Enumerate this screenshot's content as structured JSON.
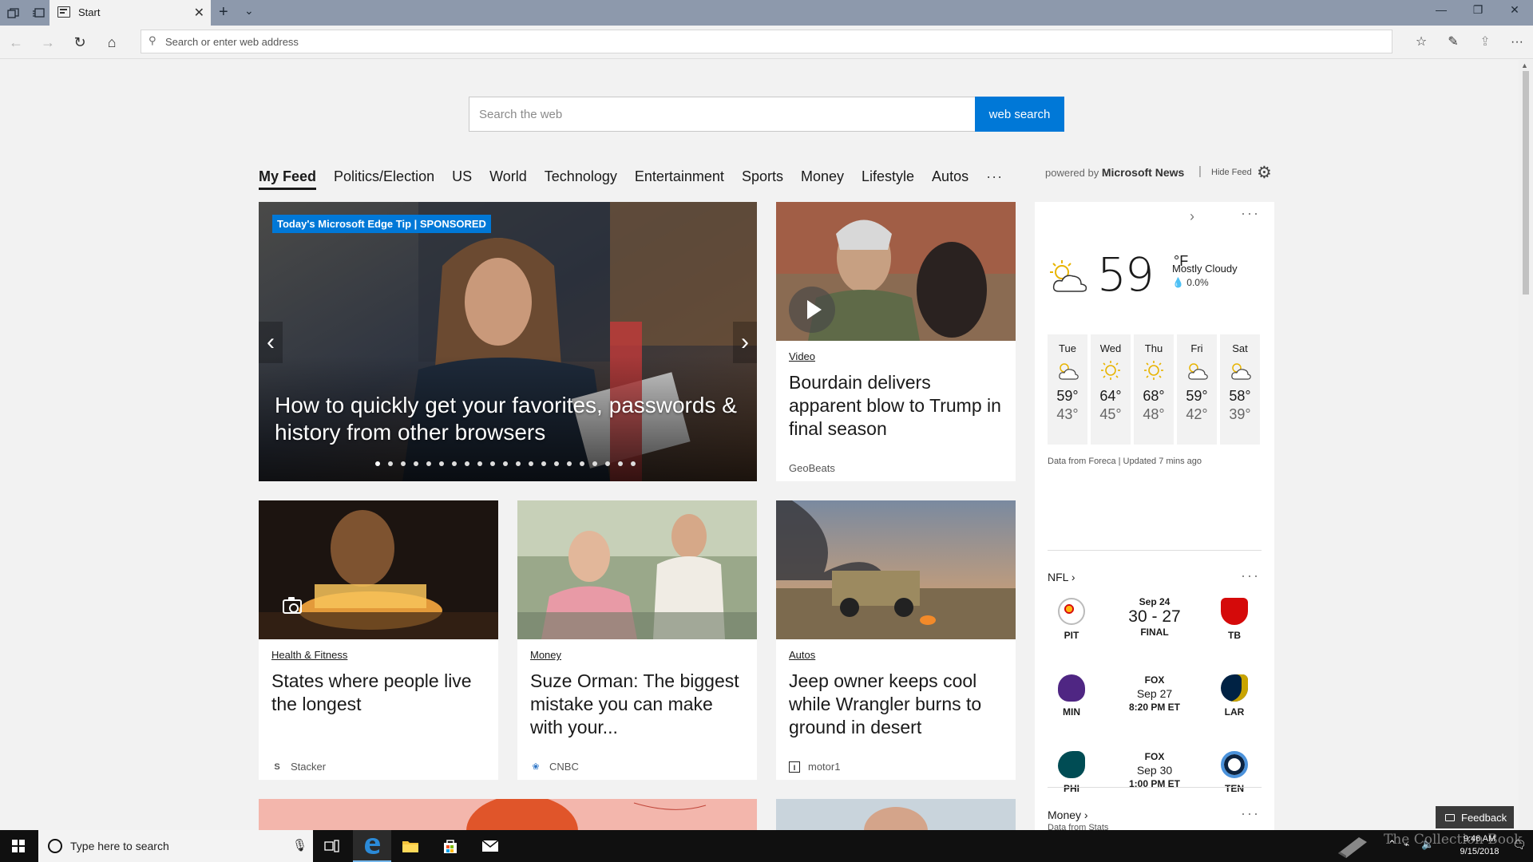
{
  "browser": {
    "tab_title": "Start",
    "address_placeholder": "Search or enter web address"
  },
  "search": {
    "placeholder": "Search the web",
    "button_label": "web search"
  },
  "feed_nav": {
    "tabs": [
      "My Feed",
      "Politics/Election",
      "US",
      "World",
      "Technology",
      "Entertainment",
      "Sports",
      "Money",
      "Lifestyle",
      "Autos"
    ],
    "more": "···",
    "powered_prefix": "powered by",
    "powered_brand": "Microsoft News",
    "separator": "|",
    "hide_feed": "Hide Feed"
  },
  "hero": {
    "badge": "Today's Microsoft Edge Tip | SPONSORED",
    "title": "How to quickly get your favorites, passwords & history from other browsers",
    "slide_count": 21,
    "active_slide": 1
  },
  "cards": [
    {
      "category": "Video",
      "title": "Bourdain delivers apparent blow to Trump in final season",
      "source": "GeoBeats",
      "source_logo": ""
    },
    {
      "category": "Health & Fitness",
      "title": "States where people live the longest",
      "source": "Stacker",
      "source_logo": "S"
    },
    {
      "category": "Money",
      "title": "Suze Orman: The biggest mistake you can make with your...",
      "source": "CNBC",
      "source_logo": "❀"
    },
    {
      "category": "Autos",
      "title": "Jeep owner keeps cool while Wrangler burns to ground in desert",
      "source": "motor1",
      "source_logo": "I"
    }
  ],
  "weather": {
    "temp": "59",
    "unit": "°F",
    "condition": "Mostly Cloudy",
    "precip": "0.0%",
    "forecast": [
      {
        "day": "Tue",
        "hi": "59°",
        "lo": "43°",
        "icon": "partly-cloudy-icon"
      },
      {
        "day": "Wed",
        "hi": "64°",
        "lo": "45°",
        "icon": "sunny-icon"
      },
      {
        "day": "Thu",
        "hi": "68°",
        "lo": "48°",
        "icon": "sunny-icon"
      },
      {
        "day": "Fri",
        "hi": "59°",
        "lo": "42°",
        "icon": "partly-cloudy-icon"
      },
      {
        "day": "Sat",
        "hi": "58°",
        "lo": "39°",
        "icon": "partly-cloudy-icon"
      }
    ],
    "source": "Data from Foreca | Updated 7 mins ago"
  },
  "nfl": {
    "title": "NFL",
    "games": [
      {
        "home": "PIT",
        "away": "TB",
        "line1": "Sep 24",
        "line2": "30 - 27",
        "line3": "FINAL",
        "home_color": "#ffb612",
        "away_color": "#d50a0a"
      },
      {
        "home": "MIN",
        "away": "LAR",
        "line1": "FOX",
        "line2": "Sep 27",
        "line3": "8:20 PM ET",
        "home_color": "#4f2683",
        "away_color": "#002244"
      },
      {
        "home": "PHI",
        "away": "TEN",
        "line1": "FOX",
        "line2": "Sep 30",
        "line3": "1:00 PM ET",
        "home_color": "#004c54",
        "away_color": "#4b92db"
      }
    ],
    "source": "Data from Stats"
  },
  "money": {
    "title": "Money"
  },
  "feedback": "Feedback",
  "taskbar": {
    "search_placeholder": "Type here to search",
    "time": "9:46 AM",
    "date": "9/15/2018"
  },
  "watermark": "The Collection Book"
}
